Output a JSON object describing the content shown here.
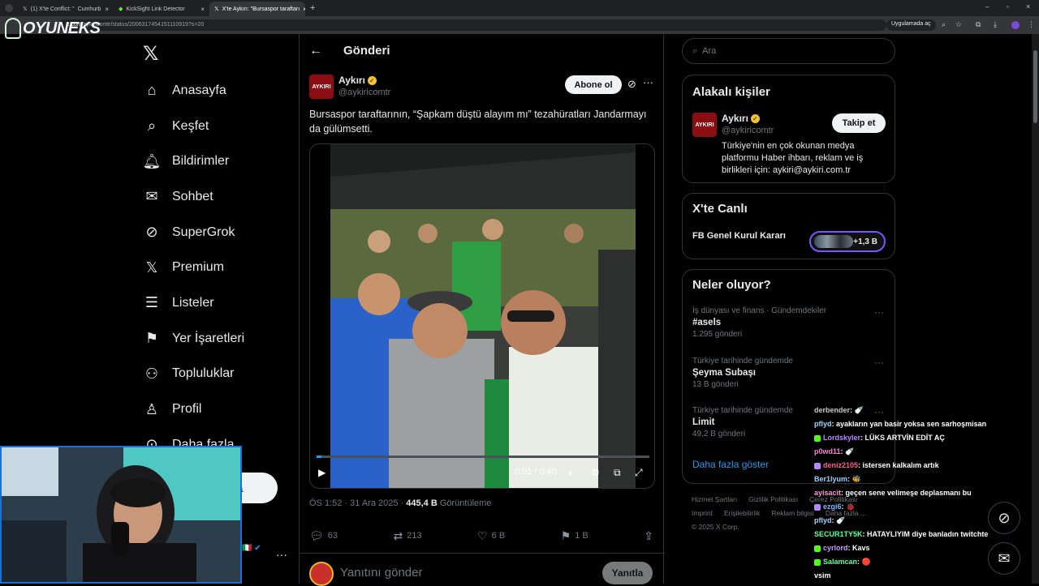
{
  "browser": {
    "tabs": [
      {
        "label": "(1) X'te Conflict: \"",
        "suffix": "Cumhurb",
        "active": false
      },
      {
        "label": "KickSight Link Detector",
        "active": false
      },
      {
        "label": "X'te Aykırı: \"Bursaspor taraftarı",
        "active": true
      }
    ],
    "url_domain": "x.com",
    "url_path": "/aykiricomtr/status/2006317454151110919?s=20",
    "app_button": "Uygulamada aç"
  },
  "overlay": {
    "logo_text": "OYUNEKS"
  },
  "nav": {
    "items": [
      {
        "label": "Anasayfa",
        "icon": "home-icon"
      },
      {
        "label": "Keşfet",
        "icon": "search-icon"
      },
      {
        "label": "Bildirimler",
        "icon": "bell-icon"
      },
      {
        "label": "Sohbet",
        "icon": "mail-icon"
      },
      {
        "label": "SuperGrok",
        "icon": "grok-icon"
      },
      {
        "label": "Premium",
        "icon": "x-premium-icon"
      },
      {
        "label": "Listeler",
        "icon": "list-icon"
      },
      {
        "label": "Yer İşaretleri",
        "icon": "bookmark-icon"
      },
      {
        "label": "Topluluklar",
        "icon": "communities-icon"
      },
      {
        "label": "Profil",
        "icon": "profile-icon"
      },
      {
        "label": "Daha fazla",
        "icon": "more-circle-icon"
      }
    ],
    "post_button_partial": "a"
  },
  "post": {
    "header_title": "Gönderi",
    "author_name": "Aykırı",
    "author_handle": "@aykiricomtr",
    "avatar_text": "AYKIRI",
    "subscribe_label": "Abone ol",
    "text": "Bursaspor taraftarının, “Şapkam düştü alayım mı” tezahüratları Jandarmayı da gülümsetti.",
    "video_time": "0:01 / 0:40",
    "video_progress": 0.015,
    "meta_time": "ÖS 1:52 · 31 Ara 2025 · ",
    "meta_views": "445,4 B",
    "meta_views_label": " Görüntüleme",
    "replies": "63",
    "reposts": "213",
    "likes": "6 B",
    "bookmarks": "1 B",
    "reply_placeholder": "Yanıtını gönder",
    "reply_button": "Yanıtla"
  },
  "sidebar": {
    "search_placeholder": "Ara",
    "related": {
      "title": "Alakalı kişiler",
      "name": "Aykırı",
      "handle": "@aykiricomtr",
      "follow_label": "Takip et",
      "bio": "Türkiye'nin en çok okunan medya platformu Haber ihbarı, reklam ve iş birlikleri için: aykiri@aykiri.com.tr"
    },
    "live": {
      "title": "X'te Canlı",
      "topic": "FB Genel Kurul Kararı",
      "count": "+1,3 B"
    },
    "trends": {
      "title": "Neler oluyor?",
      "items": [
        {
          "category": "İş dünyası ve finans · Gündemdekiler",
          "name": "#asels",
          "count": "1.295 gönderi"
        },
        {
          "category": "Türkiye tarihinde gündemde",
          "name": "Şeyma Subaşı",
          "count": "13 B gönderi"
        },
        {
          "category": "Türkiye tarihinde gündemde",
          "name": "Limit",
          "count": "49,2 B gönderi"
        }
      ],
      "show_more": "Daha fazla göster"
    },
    "footer": {
      "links": [
        "Hizmet Şartları",
        "Gizlilik Politikası",
        "Çerez Politikası",
        "Imprint",
        "Erişilebilirlik",
        "Reklam bilgisi",
        "Daha fazla ..."
      ],
      "copyright": "© 2025 X Corp."
    }
  },
  "chat": [
    {
      "user": "derbender",
      "msg": ": 🍼",
      "color": "#c8c8c8",
      "badge": ""
    },
    {
      "user": "pflyd",
      "msg": ": ayakların yan basir yoksa sen sarhoşmisan",
      "color": "#9fd4ff",
      "badge": ""
    },
    {
      "user": "Lordskyler",
      "msg": ": LÜKS ARTVİN EDİT AÇ",
      "color": "#b388ff",
      "badge": "#53fc18"
    },
    {
      "user": "p0wd11",
      "msg": ": 🍼",
      "color": "#ff7ad9",
      "badge": ""
    },
    {
      "user": "deniz2105",
      "msg": ": istersen kalkalım artık",
      "color": "#ff5e8a",
      "badge": "#b388ff"
    },
    {
      "user": "Ber1lyum",
      "msg": ": 🐝",
      "color": "#8fd3ff",
      "badge": ""
    },
    {
      "user": "ayisacit",
      "msg": ": geçen sene velimeşe deplasmanı bu",
      "color": "#ff9ad5",
      "badge": ""
    },
    {
      "user": "ezgi6",
      "msg": ": 🐞",
      "color": "#7fb8ff",
      "badge": "#b388ff"
    },
    {
      "user": "pflyd",
      "msg": ": 🍼",
      "color": "#9fd4ff",
      "badge": ""
    },
    {
      "user": "SECUR1TY5K",
      "msg": ": HATAYLIYIM diye banladın twitchte",
      "color": "#5dff9d",
      "badge": ""
    },
    {
      "user": "cyrlord",
      "msg": ": Kavs",
      "color": "#c59bff",
      "badge": "#53fc18"
    },
    {
      "user": "Salamcan",
      "msg": ": 🔴",
      "color": "#5dff9d",
      "badge": "#53fc18"
    },
    {
      "user": "vsim",
      "msg": "",
      "color": "#ffffff",
      "badge": ""
    }
  ],
  "colors": {
    "accent": "#1d9bf0",
    "aykiri_red": "#8b0d12",
    "live_border": "#7856ff",
    "verified_gold": "#f4c430"
  }
}
